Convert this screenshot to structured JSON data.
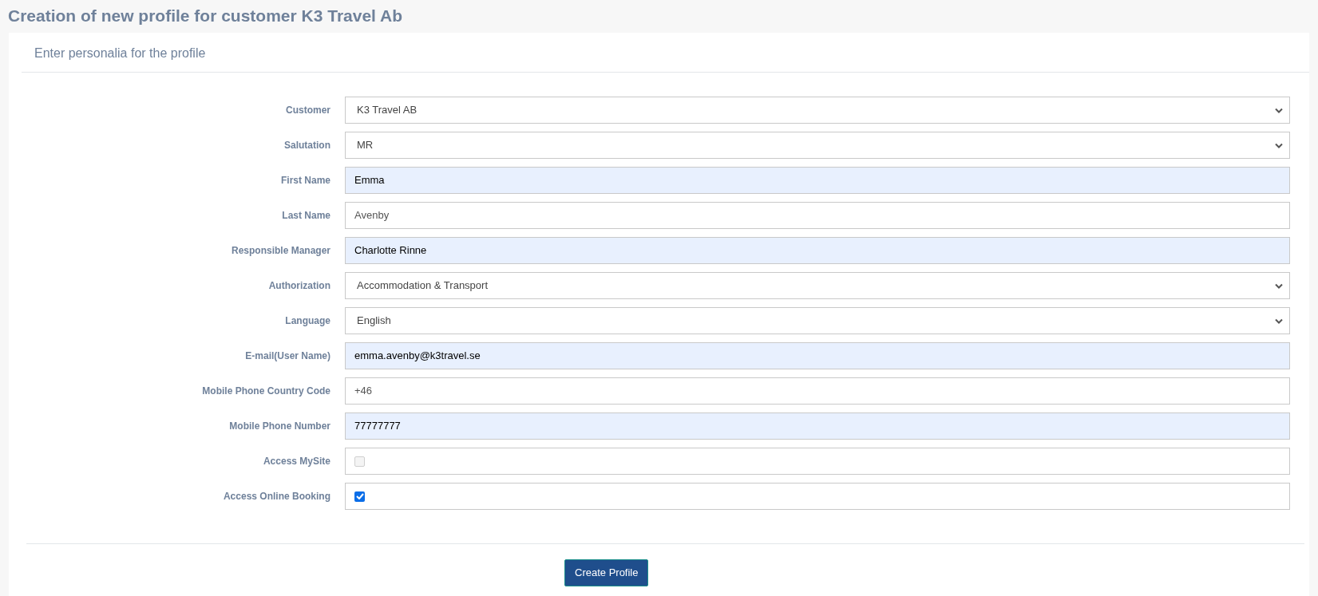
{
  "page_title": "Creation of new profile for customer K3 Travel Ab",
  "section_title": "Enter personalia for the profile",
  "fields": [
    {
      "kind": "select",
      "label": "Customer",
      "value": "K3 Travel AB"
    },
    {
      "kind": "select",
      "label": "Salutation",
      "value": "MR"
    },
    {
      "kind": "text",
      "label": "First Name",
      "value": "Emma",
      "autofilled": true
    },
    {
      "kind": "text",
      "label": "Last Name",
      "value": "Avenby",
      "autofilled": false
    },
    {
      "kind": "text",
      "label": "Responsible Manager",
      "value": "Charlotte Rinne",
      "autofilled": true
    },
    {
      "kind": "select",
      "label": "Authorization",
      "value": "Accommodation & Transport"
    },
    {
      "kind": "select",
      "label": "Language",
      "value": "English"
    },
    {
      "kind": "text",
      "label": "E-mail(User Name)",
      "value": "emma.avenby@k3travel.se",
      "autofilled": true
    },
    {
      "kind": "text",
      "label": "Mobile Phone Country Code",
      "value": "+46",
      "autofilled": false
    },
    {
      "kind": "text",
      "label": "Mobile Phone Number",
      "value": "77777777",
      "autofilled": true
    },
    {
      "kind": "checkbox",
      "label": "Access MySite",
      "checked": false,
      "disabled": true
    },
    {
      "kind": "checkbox",
      "label": "Access Online Booking",
      "checked": true,
      "disabled": false
    }
  ],
  "submit_button": "Create Profile"
}
